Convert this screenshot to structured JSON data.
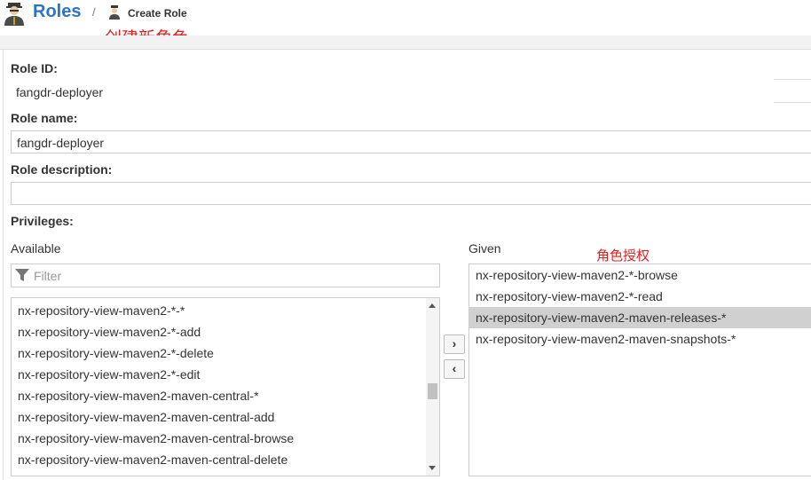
{
  "header": {
    "title": "Roles",
    "separator": "/",
    "breadcrumb": "Create Role",
    "annotation": "创建新角色",
    "icons": {
      "roles": "role-person-icon",
      "breadcrumb": "role-person-icon"
    }
  },
  "form": {
    "role_id_label": "Role ID:",
    "role_id_value": "fangdr-deployer",
    "role_name_label": "Role name:",
    "role_name_value": "fangdr-deployer",
    "role_description_label": "Role description:",
    "role_description_value": "",
    "privileges_label": "Privileges:"
  },
  "privileges": {
    "available_label": "Available",
    "given_label": "Given",
    "annotation": "角色授权",
    "filter_placeholder": "Filter",
    "filter_icon": "funnel-icon",
    "available": [
      "nx-repository-view-maven2-*-*",
      "nx-repository-view-maven2-*-add",
      "nx-repository-view-maven2-*-delete",
      "nx-repository-view-maven2-*-edit",
      "nx-repository-view-maven2-maven-central-*",
      "nx-repository-view-maven2-maven-central-add",
      "nx-repository-view-maven2-maven-central-browse",
      "nx-repository-view-maven2-maven-central-delete"
    ],
    "given": [
      "nx-repository-view-maven2-*-browse",
      "nx-repository-view-maven2-*-read",
      "nx-repository-view-maven2-maven-releases-*",
      "nx-repository-view-maven2-maven-snapshots-*"
    ],
    "given_selected_index": 2,
    "add_button": "›",
    "remove_button": "‹"
  },
  "colors": {
    "title": "#2d74c4",
    "annotation": "#e02020",
    "selected_row": "#d0d0d0"
  }
}
